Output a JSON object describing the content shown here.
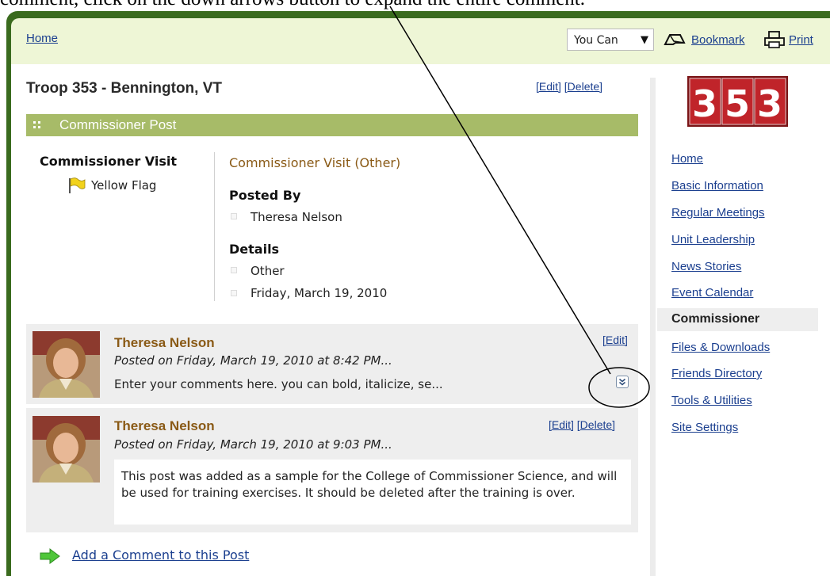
{
  "caption": "comment, click on the down arrows button to expand the entire comment.",
  "header": {
    "home_label": "Home",
    "you_can_label": "You Can",
    "bookmark_label": "Bookmark",
    "print_label": "Print"
  },
  "page": {
    "title": "Troop 353 - Bennington, VT",
    "edit_label": "[Edit]",
    "delete_label": "[Delete]",
    "section_title": "Commissioner Post"
  },
  "post": {
    "visit_type": "Commissioner Visit",
    "flag_label": "Yellow Flag",
    "subtitle": "Commissioner Visit (Other)",
    "posted_by_heading": "Posted By",
    "posted_by": "Theresa Nelson",
    "details_heading": "Details",
    "detail_category": "Other",
    "detail_date": "Friday, March 19, 2010"
  },
  "comments": [
    {
      "author": "Theresa Nelson",
      "posted": "Posted on Friday, March 19, 2010 at 8:42 PM...",
      "text": "Enter your comments here. you can bold, italicize, se...",
      "edit_label": "[Edit]"
    },
    {
      "author": "Theresa Nelson",
      "posted": "Posted on Friday, March 19, 2010 at 9:03 PM...",
      "text": "This post was added as a sample for the College of Commissioner Science, and will be used for training exercises. It should be deleted after the training is over.",
      "edit_label": "[Edit]",
      "delete_label": "[Delete]"
    }
  ],
  "add_comment_label": "Add a Comment to this Post",
  "logo_digits": [
    "3",
    "5",
    "3"
  ],
  "sidebar": {
    "items": [
      {
        "label": "Home"
      },
      {
        "label": "Basic Information"
      },
      {
        "label": "Regular Meetings"
      },
      {
        "label": "Unit Leadership"
      },
      {
        "label": "News Stories"
      },
      {
        "label": "Event Calendar"
      },
      {
        "label": "Commissioner",
        "active": true
      },
      {
        "label": "Files & Downloads"
      },
      {
        "label": "Friends Directory"
      },
      {
        "label": "Tools & Utilities"
      },
      {
        "label": "Site Settings"
      }
    ]
  },
  "colors": {
    "frame_green": "#3a6b1e",
    "section_bar": "#a7bb68",
    "link_blue": "#1b3f8f",
    "author_brown": "#8a5a16",
    "logo_red": "#c0242a"
  }
}
